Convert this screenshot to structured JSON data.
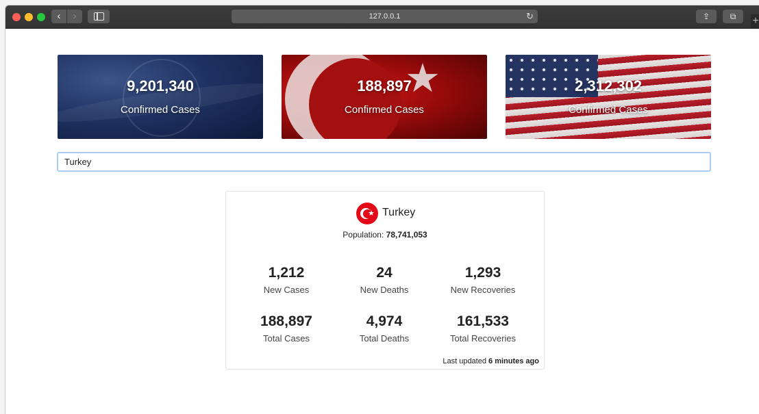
{
  "browser": {
    "url": "127.0.0.1",
    "back_glyph": "‹",
    "forward_glyph": "›",
    "reload_glyph": "↻",
    "share_glyph": "⇪",
    "tabs_glyph": "⧉",
    "new_tab_glyph": "+"
  },
  "cards": [
    {
      "region": "world",
      "number": "9,201,340",
      "label": "Confirmed Cases"
    },
    {
      "region": "turkey",
      "number": "188,897",
      "label": "Confirmed Cases"
    },
    {
      "region": "usa",
      "number": "2,312,302",
      "label": "Confirmed Cases"
    }
  ],
  "search": {
    "value": "Turkey"
  },
  "country": {
    "name": "Turkey",
    "population_label": "Population: ",
    "population_value": "78,741,053",
    "stats": [
      {
        "value": "1,212",
        "label": "New Cases"
      },
      {
        "value": "24",
        "label": "New Deaths"
      },
      {
        "value": "1,293",
        "label": "New Recoveries"
      },
      {
        "value": "188,897",
        "label": "Total Cases"
      },
      {
        "value": "4,974",
        "label": "Total Deaths"
      },
      {
        "value": "161,533",
        "label": "Total Recoveries"
      }
    ],
    "updated_label": "Last updated ",
    "updated_value": "6 minutes ago"
  },
  "colors": {
    "turkey_red": "#e30a17",
    "search_focus": "#a9cdf6"
  }
}
